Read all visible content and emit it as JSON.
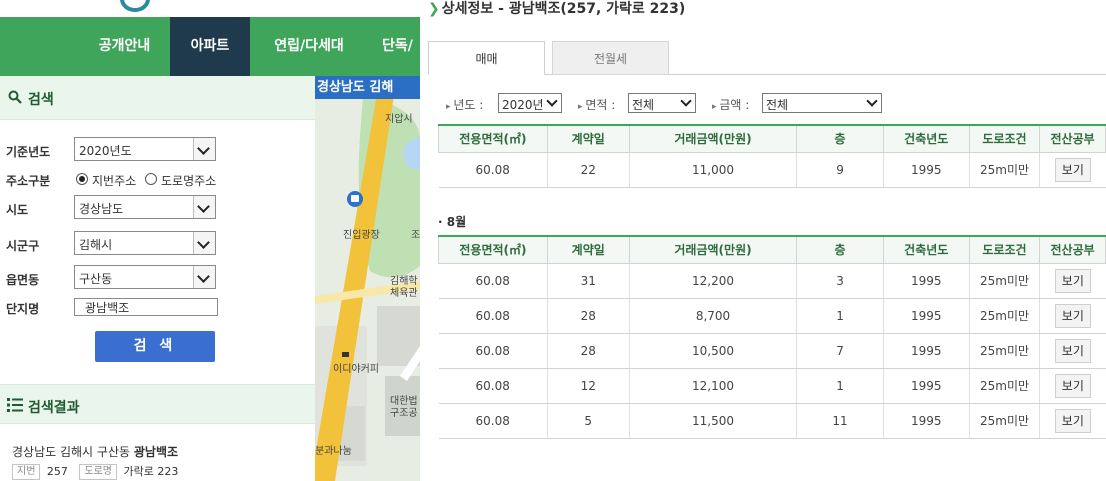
{
  "nav": {
    "items": [
      "공개안내",
      "아파트",
      "연립/다세대",
      "단독/"
    ],
    "active_index": 1
  },
  "search": {
    "title": "검색",
    "year_label": "기준년도",
    "year_value": "2020년도",
    "address_type_label": "주소구분",
    "address_type_options": [
      "지번주소",
      "도로명주소"
    ],
    "sido_label": "시도",
    "sido_value": "경상남도",
    "sigungu_label": "시군구",
    "sigungu_value": "김해시",
    "dong_label": "읍면동",
    "dong_value": "구산동",
    "complex_label": "단지명",
    "complex_value": "광남백조",
    "button": "검 색"
  },
  "results": {
    "title": "검색결과",
    "item_prefix": "경상남도 김해시 구산동",
    "item_name": "광남백조",
    "jibun_tag": "지번",
    "jibun_value": "257",
    "road_tag": "도로명",
    "road_value": "가락로 223"
  },
  "map": {
    "banner": "경상남도 김해",
    "labels": [
      "지압시",
      "진입광장",
      "조",
      "김해학",
      "체육관",
      "이디야커피",
      "대한법",
      "구조공",
      "분과나눔"
    ]
  },
  "detail": {
    "title": "상세정보 - 광남백조(257, 가락로 223)",
    "tabs": [
      "매매",
      "전월세"
    ],
    "active_tab": 0,
    "filters": {
      "year_label": "년도 :",
      "year_value": "2020년",
      "area_label": "면적 :",
      "area_value": "전체",
      "price_label": "금액 :",
      "price_value": "전체"
    },
    "columns": [
      "전용면적(㎡)",
      "계약일",
      "거래금액(만원)",
      "층",
      "건축년도",
      "도로조건",
      "전산공부"
    ],
    "view_label": "보기",
    "first_table_rows": [
      [
        "60.08",
        "22",
        "11,000",
        "9",
        "1995",
        "25m미만"
      ]
    ],
    "month_label": "8월",
    "second_table_rows": [
      [
        "60.08",
        "31",
        "12,200",
        "3",
        "1995",
        "25m미만"
      ],
      [
        "60.08",
        "28",
        "8,700",
        "1",
        "1995",
        "25m미만"
      ],
      [
        "60.08",
        "28",
        "10,500",
        "7",
        "1995",
        "25m미만"
      ],
      [
        "60.08",
        "12",
        "12,100",
        "1",
        "1995",
        "25m미만"
      ],
      [
        "60.08",
        "5",
        "11,500",
        "11",
        "1995",
        "25m미만"
      ]
    ]
  },
  "colors": {
    "nav_green": "#3fa55a",
    "nav_active": "#1f3a4d",
    "search_button": "#3a6fd1",
    "map_banner": "#2b6fc4"
  }
}
